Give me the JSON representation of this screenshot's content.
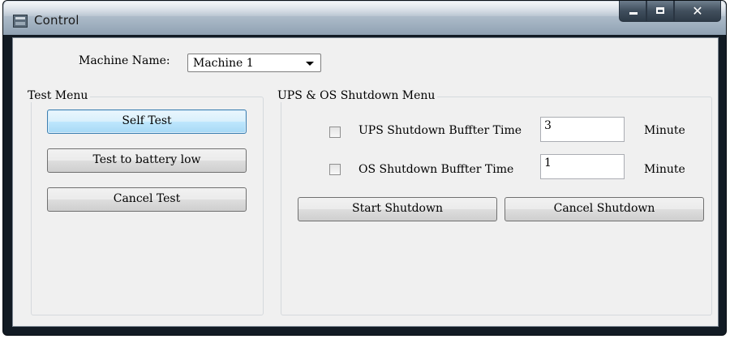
{
  "window": {
    "title": "Control",
    "icon": "ups-app-icon",
    "controls": [
      "minimize",
      "maximize",
      "close"
    ],
    "close_glyph": "✕"
  },
  "machine": {
    "label": "Machine Name:",
    "selected": "Machine 1"
  },
  "test_menu": {
    "title": "Test Menu",
    "buttons": [
      "Self Test",
      "Test to battery low",
      "Cancel Test"
    ]
  },
  "shutdown_menu": {
    "title": "UPS & OS Shutdown Menu",
    "ups": {
      "label": "UPS Shutdown Buffter Time",
      "value": "3",
      "unit": "Minute",
      "checked": false
    },
    "os": {
      "label": "OS Shutdown Buffter Time",
      "value": "1",
      "unit": "Minute",
      "checked": false
    },
    "start_button": "Start Shutdown",
    "cancel_button": "Cancel Shutdown"
  },
  "colors": {
    "focus_border": "#3c7fb1",
    "client_bg": "#f0f0f0",
    "frame_dark": "#121b24"
  }
}
